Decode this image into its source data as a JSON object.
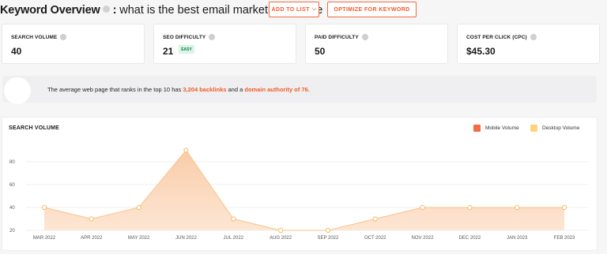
{
  "header": {
    "title_bold": "Keyword Overview",
    "separator": ":",
    "keyword": "what is the best email marketing service",
    "add_to_list": "ADD TO LIST",
    "optimize": "OPTIMIZE FOR KEYWORD"
  },
  "metrics": [
    {
      "label": "SEARCH VOLUME",
      "value": "40"
    },
    {
      "label": "SEO DIFFICULTY",
      "value": "21",
      "badge": "EASY"
    },
    {
      "label": "PAID DIFFICULTY",
      "value": "50"
    },
    {
      "label": "COST PER CLICK (CPC)",
      "value": "$45.30"
    }
  ],
  "banner": {
    "prefix": "The average web page that ranks in the top 10 has ",
    "backlinks": "3,204 backlinks",
    "middle": " and a ",
    "authority": "domain authority of 76",
    "suffix": "."
  },
  "colors": {
    "accent": "#f05a28",
    "mobile": "#f26b42",
    "desktop": "#fdd37a",
    "area_fill": "#fbd7b8",
    "area_line": "#f7c488"
  },
  "chart_data": {
    "type": "area",
    "title": "SEARCH VOLUME",
    "categories": [
      "MAR 2022",
      "APR 2022",
      "MAY 2022",
      "JUN 2022",
      "JUL 2022",
      "AUG 2022",
      "SEP 2022",
      "OCT 2022",
      "NOV 2022",
      "DEC 2022",
      "JAN 2023",
      "FEB 2023"
    ],
    "series": [
      {
        "name": "Desktop Volume",
        "values": [
          40,
          30,
          40,
          90,
          30,
          20,
          20,
          30,
          40,
          40,
          40,
          40
        ]
      }
    ],
    "legend": [
      "Mobile Volume",
      "Desktop Volume"
    ],
    "yticks": [
      20,
      40,
      60,
      80
    ],
    "ylim": [
      20,
      100
    ],
    "grid": true,
    "legend_position": "top-right"
  }
}
